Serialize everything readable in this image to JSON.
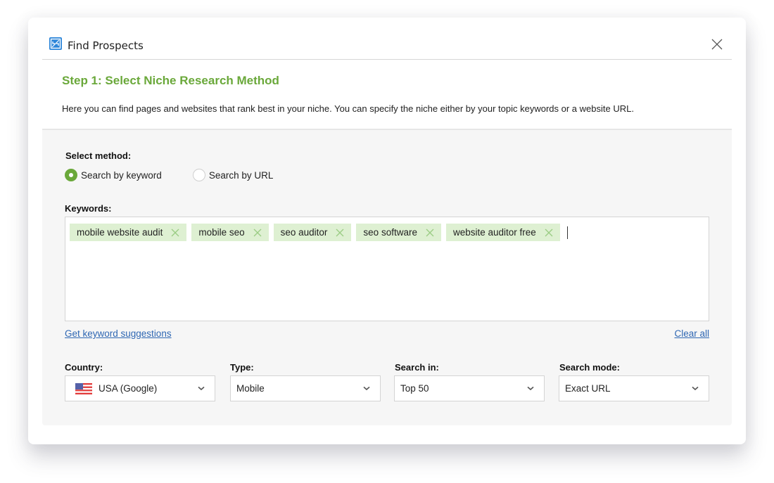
{
  "dialog": {
    "title": "Find Prospects",
    "icon": "find-prospects-app-icon",
    "close_icon": "close-icon"
  },
  "header": {
    "step_title": "Step 1: Select Niche Research Method",
    "description": "Here you can find pages and websites that rank best in your niche. You can specify the niche either by your topic keywords or a website URL."
  },
  "method": {
    "label": "Select method:",
    "options": [
      {
        "label": "Search by keyword",
        "checked": true
      },
      {
        "label": "Search by URL",
        "checked": false
      }
    ]
  },
  "keywords": {
    "label": "Keywords:",
    "tags": [
      "mobile website audit",
      "mobile seo",
      "seo auditor",
      "seo software",
      "website auditor free"
    ],
    "suggestions_link": "Get keyword suggestions",
    "clear_all_link": "Clear all"
  },
  "fields": {
    "country": {
      "label": "Country:",
      "value": "USA (Google)",
      "flag_icon": "us-flag-icon"
    },
    "type": {
      "label": "Type:",
      "value": "Mobile"
    },
    "search_in": {
      "label": "Search in:",
      "value": "Top 50"
    },
    "search_mode": {
      "label": "Search mode:",
      "value": "Exact URL"
    }
  },
  "colors": {
    "accent_green": "#6aa83a",
    "tag_background": "#def0d2",
    "link_blue": "#2f67b3",
    "icon_blue": "#2d86d9"
  }
}
